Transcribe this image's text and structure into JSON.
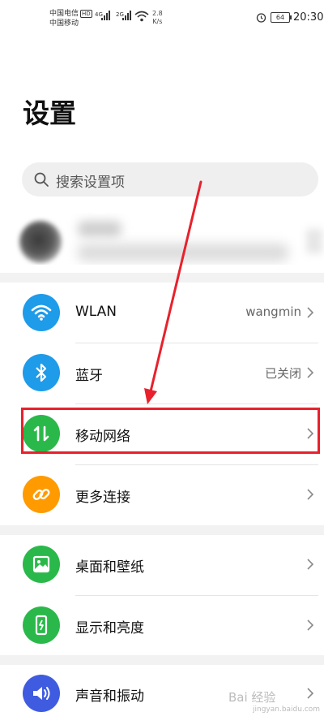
{
  "status_bar": {
    "carrier_1": "中国电信",
    "hd": "HD",
    "carrier_2": "中国移动",
    "net_1": "4G",
    "net_2": "2G",
    "speed_value": "2.8",
    "speed_unit": "K/s",
    "battery": "64",
    "time": "20:30"
  },
  "page_title": "设置",
  "search": {
    "placeholder": "搜索设置项"
  },
  "items": [
    {
      "label": "WLAN",
      "value": "wangmin",
      "icon": "wifi-icon",
      "color": "#1e9be9"
    },
    {
      "label": "蓝牙",
      "value": "已关闭",
      "icon": "bluetooth-icon",
      "color": "#1e9be9"
    },
    {
      "label": "移动网络",
      "value": "",
      "icon": "mobile-data-icon",
      "color": "#2bb84a"
    },
    {
      "label": "更多连接",
      "value": "",
      "icon": "link-icon",
      "color": "#ff9a00"
    },
    {
      "label": "桌面和壁纸",
      "value": "",
      "icon": "wallpaper-icon",
      "color": "#2bb84a"
    },
    {
      "label": "显示和亮度",
      "value": "",
      "icon": "display-icon",
      "color": "#2bb84a"
    },
    {
      "label": "声音和振动",
      "value": "",
      "icon": "sound-icon",
      "color": "#3f5be0"
    }
  ],
  "annotation_color": "#e8212c",
  "watermark": {
    "main": "Bai 经验",
    "sub": "jingyan.baidu.com"
  }
}
